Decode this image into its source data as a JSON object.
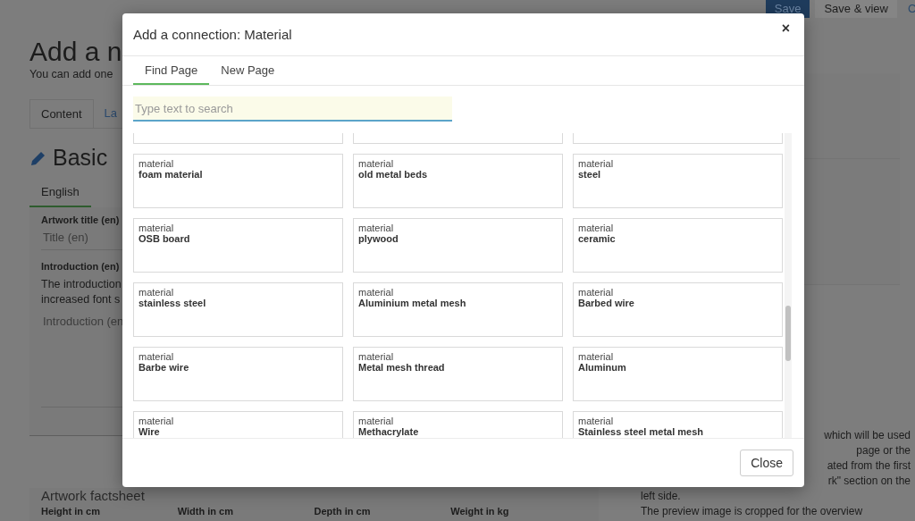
{
  "page": {
    "buttons": [
      {
        "label": "Save",
        "kind": "primary"
      },
      {
        "label": "Save & view",
        "kind": "secondary"
      },
      {
        "label": "C",
        "kind": "link"
      }
    ],
    "title": "Add a n",
    "subtitle": "You can add one",
    "tabs": [
      {
        "label": "Content",
        "selected": true
      },
      {
        "label": "La",
        "selected": false
      }
    ],
    "section_title": "Basic",
    "language_tabs": [
      {
        "label": "English",
        "selected": true
      }
    ],
    "title_field": {
      "label": "Artwork title (en)",
      "placeholder": "Title (en)"
    },
    "intro_field": {
      "label": "Introduction (en)",
      "hint": "The introduction",
      "hint_2": "increased font s",
      "placeholder": "Introduction (en"
    },
    "factsheet": {
      "title": "Artwork factsheet",
      "columns": [
        "Height in cm",
        "Width in cm",
        "Depth in cm",
        "Weight in kg"
      ]
    },
    "side_text": {
      "cut_lines": [
        "which will be used",
        "page or the",
        "ated from the first",
        "rk\" section on the"
      ],
      "lines": [
        "left side.",
        "The preview image is cropped for the overview"
      ]
    }
  },
  "dialog": {
    "title": "Add a connection: Material",
    "close_icon": "×",
    "tabs": [
      {
        "label": "Find Page",
        "selected": true
      },
      {
        "label": "New Page",
        "selected": false
      }
    ],
    "search": {
      "placeholder": "Type text to search"
    },
    "results": [
      {
        "type": "material",
        "name": "foam material"
      },
      {
        "type": "material",
        "name": "old metal beds"
      },
      {
        "type": "material",
        "name": "steel"
      },
      {
        "type": "material",
        "name": "OSB board"
      },
      {
        "type": "material",
        "name": "plywood"
      },
      {
        "type": "material",
        "name": "ceramic"
      },
      {
        "type": "material",
        "name": "stainless steel"
      },
      {
        "type": "material",
        "name": "Aluminium metal mesh"
      },
      {
        "type": "material",
        "name": "Barbed wire"
      },
      {
        "type": "material",
        "name": "Barbe wire"
      },
      {
        "type": "material",
        "name": "Metal mesh thread"
      },
      {
        "type": "material",
        "name": "Aluminum"
      },
      {
        "type": "material",
        "name": "Wire"
      },
      {
        "type": "material",
        "name": "Methacrylate"
      },
      {
        "type": "material",
        "name": "Stainless steel metal mesh"
      }
    ],
    "close_button": "Close"
  }
}
